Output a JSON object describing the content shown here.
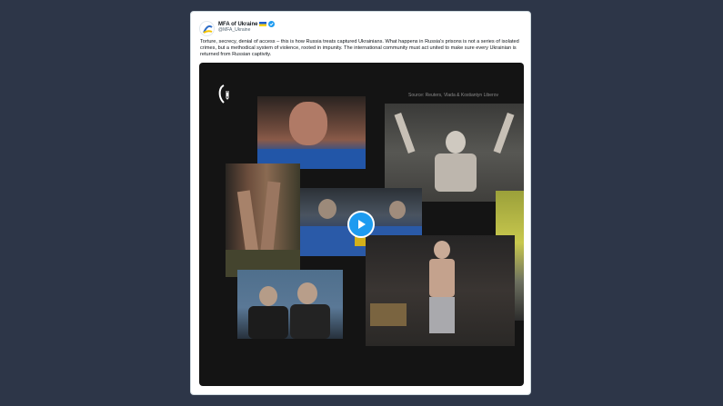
{
  "account": {
    "name": "MFA of Ukraine",
    "handle": "@MFA_Ukraine",
    "verified": true
  },
  "tweet": {
    "text": "Torture, secrecy, denial of access – this is how Russia treats captured Ukrainians. What happens in Russia's prisons is not a series of isolated crimes, but a methodical system of violence, rooted in impunity. The international community must act united to make sure every Ukrainian is returned from Russian captivity."
  },
  "video": {
    "source_caption": "Source: Reuters, Vlada & Kostiantyn Liberov",
    "play_icon": "play-icon"
  },
  "colors": {
    "page_background": "#2d3648",
    "accent": "#1d9bf0",
    "media_background": "#141414"
  }
}
